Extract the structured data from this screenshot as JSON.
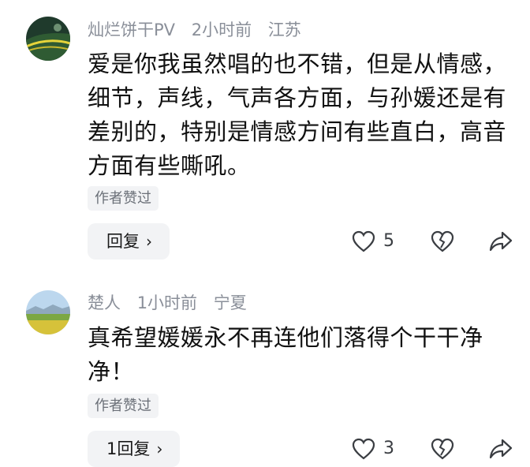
{
  "comments": [
    {
      "user": "灿烂饼干PV",
      "time": "2小时前",
      "location": "江苏",
      "text": "爱是你我虽然唱的也不错，但是从情感，细节，声线，气声各方面，与孙媛还是有差别的，特别是情感方间有些直白，高音方面有些嘶吼。",
      "author_liked": "作者赞过",
      "reply_label": "回复",
      "like_count": "5",
      "avatar_icon": "landscape-avatar-icon"
    },
    {
      "user": "楚人",
      "time": "1小时前",
      "location": "宁夏",
      "text": "真希望媛媛永不再连他们落得个干干净净！",
      "author_liked": "作者赞过",
      "reply_label": "1回复",
      "like_count": "3",
      "avatar_icon": "grassland-avatar-icon"
    }
  ],
  "colors": {
    "meta_text": "#8a8f99",
    "tag_bg": "#f2f3f5",
    "icon": "#3a3d42"
  }
}
